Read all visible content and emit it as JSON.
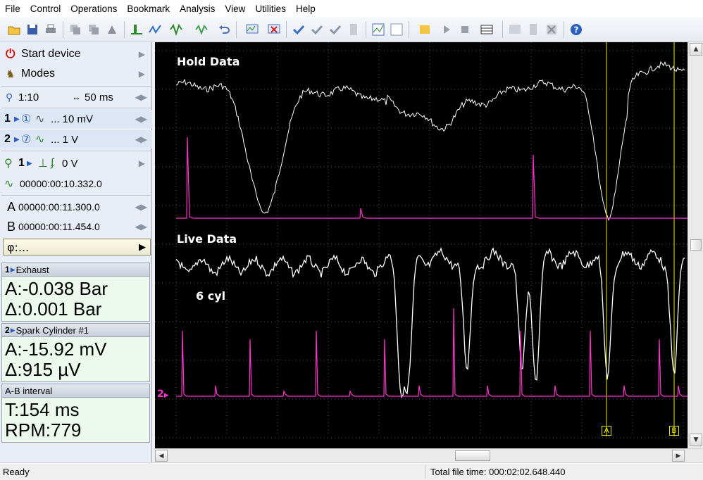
{
  "menu": [
    "File",
    "Control",
    "Operations",
    "Bookmark",
    "Analysis",
    "View",
    "Utilities",
    "Help"
  ],
  "toolbar": {
    "icons": [
      "open-icon",
      "save-icon",
      "print-icon",
      "copy-icon",
      "paste-icon",
      "stamp-icon",
      "trigger-icon",
      "trigger-mode-icon",
      "waveform-icon",
      "waveform2-icon",
      "undo-icon",
      "zoom-graph-icon",
      "clear-graph-icon",
      "check-icon",
      "check-down-icon",
      "check-double-icon",
      "document-icon",
      "grid-icon",
      "grid-tool-icon",
      "math-icon",
      "math-play-icon",
      "math-stop-icon",
      "math-table-icon",
      "chart-icon",
      "page-icon",
      "cross-icon",
      "help-icon"
    ]
  },
  "left_panel": {
    "start_device": "Start device",
    "modes": "Modes",
    "zoom": "1:10",
    "timebase": "50 ms",
    "ch1_scale": "... 10 mV",
    "ch2_scale": "... 1 V",
    "trigger_level": "0 V",
    "trigger_time": "00000:00:10.332.0",
    "cursor_a_time": "00000:00:11.300.0",
    "cursor_b_time": "00000:00:11.454.0",
    "phi_label": "φ:...",
    "readout_1": {
      "header": "Exhaust",
      "line1": "A:-0.038 Bar",
      "line2": "Δ:0.001 Bar"
    },
    "readout_2": {
      "header": "Spark Cylinder #1",
      "line1": "A:-15.92 mV",
      "line2": "Δ:915 µV"
    },
    "readout_3": {
      "header": "A-B interval",
      "line1": "T:154 ms",
      "line2": "RPM:779"
    }
  },
  "scope": {
    "hold_label": "Hold Data",
    "live_label": "Live Data",
    "cyl_label": "6 cyl",
    "channel_marker": "2",
    "cursor_a": "A",
    "cursor_b": "B",
    "colors": {
      "waveform": "#ffffff",
      "spark": "#ff33cc",
      "cursor": "#e6e600",
      "grid": "#555555"
    }
  },
  "status": {
    "left": "Ready",
    "right": "Total file time: 000:02:02.648.440"
  }
}
